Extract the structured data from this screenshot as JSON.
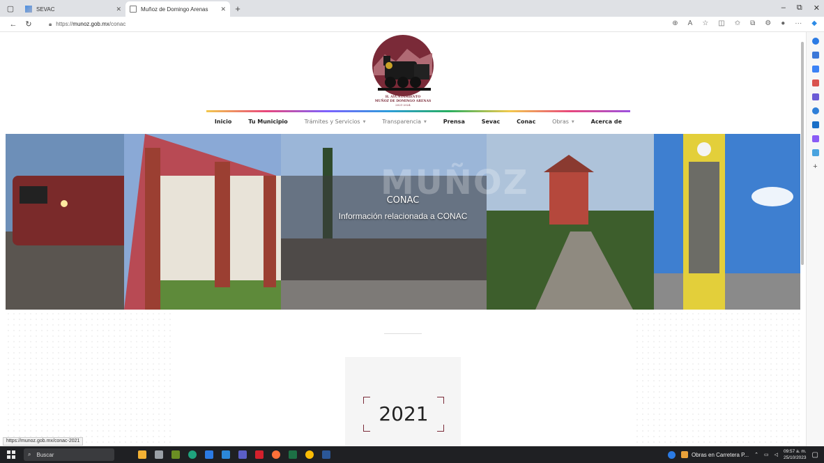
{
  "browser": {
    "tabs": [
      {
        "title": "SEVAC",
        "active": false
      },
      {
        "title": "Muñoz de Domingo Arenas",
        "active": true
      }
    ],
    "new_tab": "+",
    "url_prefix": "https://",
    "url_host": "munoz.gob.mx",
    "url_path": "/conac",
    "status_url": "https://munoz.gob.mx/conac-2021"
  },
  "logo": {
    "line1": "H. AYUNTAMIENTO",
    "line2": "MUÑOZ DE DOMINGO ARENAS",
    "line3": "2021-2024"
  },
  "nav": {
    "items": [
      {
        "label": "Inicio",
        "style": "bold",
        "dropdown": false
      },
      {
        "label": "Tu Municipio",
        "style": "bold",
        "dropdown": false
      },
      {
        "label": "Trámites y Servicios",
        "style": "light",
        "dropdown": true
      },
      {
        "label": "Transparencia",
        "style": "light",
        "dropdown": true
      },
      {
        "label": "Prensa",
        "style": "bold",
        "dropdown": false
      },
      {
        "label": "Sevac",
        "style": "bold",
        "dropdown": false
      },
      {
        "label": "Conac",
        "style": "bold",
        "dropdown": false
      },
      {
        "label": "Obras",
        "style": "light",
        "dropdown": true
      },
      {
        "label": "Acerca de",
        "style": "bold",
        "dropdown": false
      }
    ]
  },
  "hero": {
    "brand": "MUÑOZ",
    "title": "CONAC",
    "subtitle": "Información relacionada a CONAC"
  },
  "content": {
    "year_card": "2021"
  },
  "taskbar": {
    "search_placeholder": "Buscar",
    "active_app": "Obras en Carretera P...",
    "time": "09:57 a. m.",
    "date": "25/10/2023"
  },
  "colors": {
    "brand_maroon": "#7a2a38",
    "taskbar": "#1f2023"
  }
}
